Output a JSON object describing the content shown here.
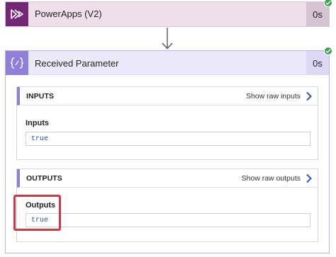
{
  "trigger": {
    "title": "PowerApps (V2)",
    "duration": "0s",
    "icon": "powerapps-icon",
    "status": "succeeded"
  },
  "action": {
    "title": "Received Parameter",
    "duration": "0s",
    "icon": "code-braces-icon",
    "status": "succeeded",
    "inputs": {
      "header": "INPUTS",
      "link": "Show raw inputs",
      "field_label": "Inputs",
      "field_value": "true"
    },
    "outputs": {
      "header": "OUTPUTS",
      "link": "Show raw outputs",
      "field_label": "Outputs",
      "field_value": "true"
    }
  },
  "colors": {
    "trigger_accent": "#742774",
    "action_accent": "#8f7fd9",
    "success": "#40a152",
    "highlight": "#d7353f"
  }
}
